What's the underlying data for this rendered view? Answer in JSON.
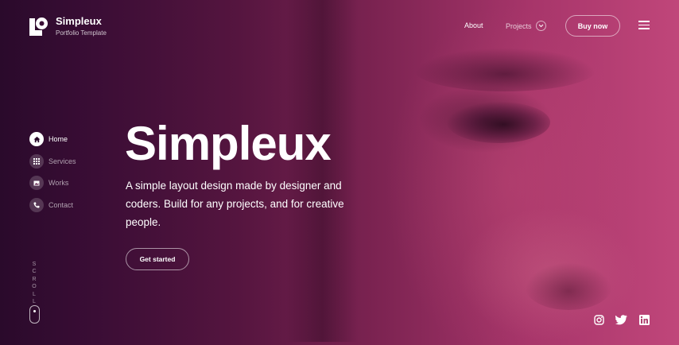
{
  "brand": {
    "name": "Simpleux",
    "tagline": "Portfolio Template",
    "logo_icon": "simpleux-logo"
  },
  "topnav": {
    "about": "About",
    "projects": "Projects",
    "projects_icon": "chevron-down-icon",
    "buy": "Buy now",
    "menu_icon": "hamburger-menu-icon"
  },
  "sidenav": {
    "items": [
      {
        "label": "Home",
        "icon": "home-icon",
        "active": true
      },
      {
        "label": "Services",
        "icon": "grid-icon",
        "active": false
      },
      {
        "label": "Works",
        "icon": "image-icon",
        "active": false
      },
      {
        "label": "Contact",
        "icon": "phone-icon",
        "active": false
      }
    ]
  },
  "hero": {
    "title": "Simpleux",
    "description": "A simple layout design made by designer and coders. Build for any projects, and for creative people.",
    "cta": "Get started",
    "background": "portrait photo with magenta-to-purple overlay"
  },
  "scroll": {
    "label": "SCROLL"
  },
  "social": [
    {
      "name": "instagram-icon"
    },
    {
      "name": "twitter-icon"
    },
    {
      "name": "linkedin-icon"
    }
  ],
  "colors": {
    "overlay_left": "#2a0a2b",
    "overlay_right": "#c0467a",
    "text": "#ffffff"
  }
}
